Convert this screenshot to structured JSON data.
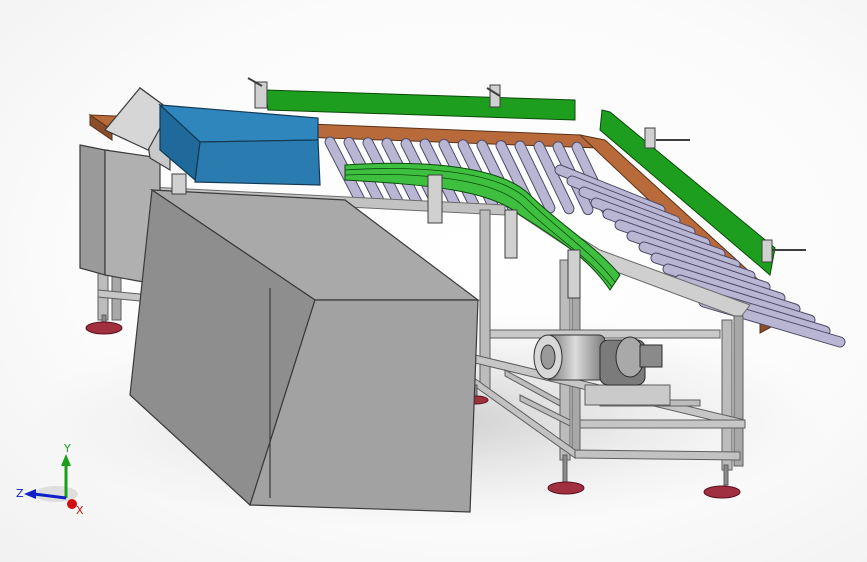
{
  "triad": {
    "x_label": "X",
    "y_label": "Y",
    "z_label": "Z",
    "x_color": "#d01010",
    "y_color": "#18a018",
    "z_color": "#1020c8"
  },
  "model_colors": {
    "frame": "#b8b8b8",
    "steel_dark": "#8f8f8f",
    "housing": "#a2a2a2",
    "hood_blue": "#2a7bb0",
    "guide_green": "#1e9e1e",
    "curved_green": "#3fbf3f",
    "side_rail_orange": "#b86a3a",
    "roller": "#b9b6d4",
    "foot_pad": "#a03040"
  }
}
